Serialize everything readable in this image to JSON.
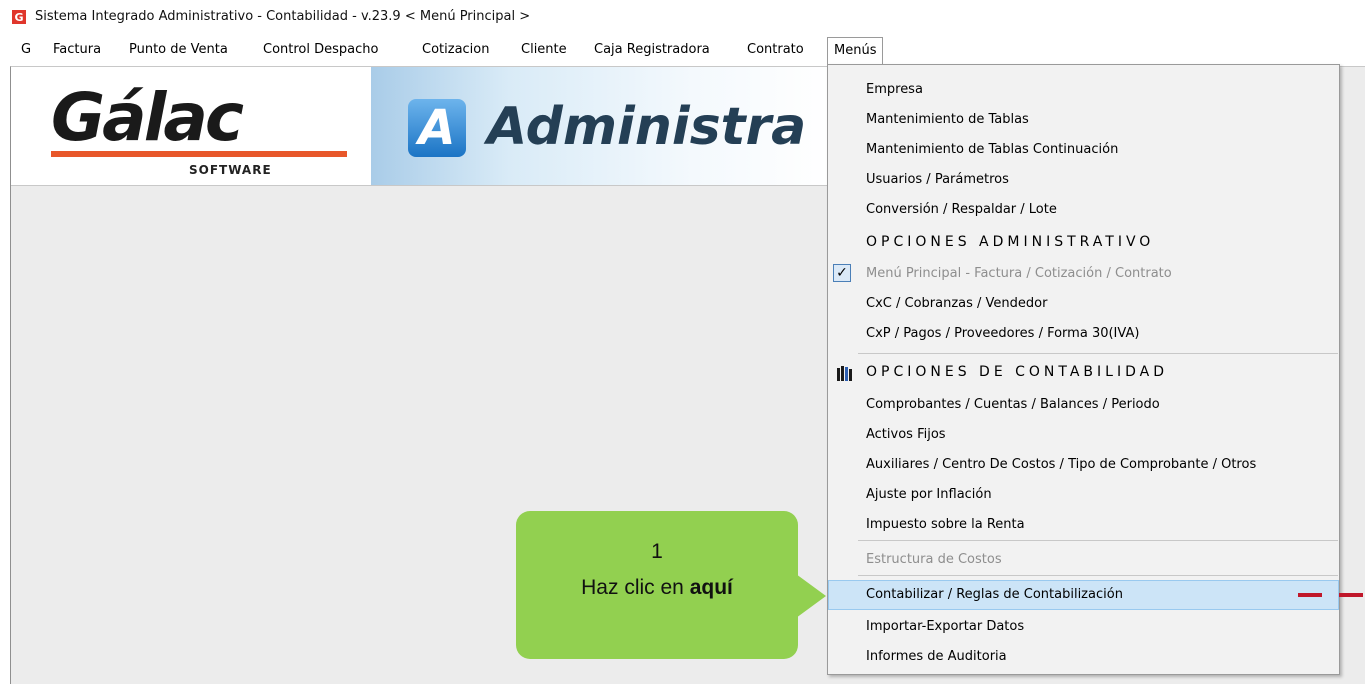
{
  "window": {
    "title": "Sistema Integrado Administrativo - Contabilidad - v.23.9 < Menú Principal >",
    "icon_letter": "G"
  },
  "menubar": {
    "items": [
      "G",
      "Factura",
      "Punto de Venta",
      "Control Despacho",
      "Cotizacion",
      "Cliente",
      "Caja Registradora",
      "Contrato",
      "Menús"
    ],
    "active": "Menús"
  },
  "banner": {
    "logo_text": "Gálac",
    "logo_subtext": "SOFTWARE",
    "badge_letter": "A",
    "product_text": "Administra"
  },
  "dropdown": {
    "items": [
      {
        "label": "Empresa",
        "kind": "item"
      },
      {
        "label": "Mantenimiento de Tablas",
        "kind": "item"
      },
      {
        "label": "Mantenimiento de Tablas Continuación",
        "kind": "item"
      },
      {
        "label": "Usuarios / Parámetros",
        "kind": "item"
      },
      {
        "label": "Conversión / Respaldar / Lote",
        "kind": "item"
      },
      {
        "label": "OPCIONES ADMINISTRATIVO",
        "kind": "section"
      },
      {
        "label": "Menú Principal - Factura / Cotización / Contrato",
        "kind": "item",
        "checked": true,
        "disabled": true
      },
      {
        "label": "CxC / Cobranzas / Vendedor",
        "kind": "item"
      },
      {
        "label": "CxP / Pagos / Proveedores / Forma 30(IVA)",
        "kind": "item"
      },
      {
        "label": "OPCIONES DE CONTABILIDAD",
        "kind": "section",
        "icon": "books-icon"
      },
      {
        "label": "Comprobantes / Cuentas / Balances / Periodo",
        "kind": "item"
      },
      {
        "label": "Activos Fijos",
        "kind": "item"
      },
      {
        "label": "Auxiliares / Centro De Costos / Tipo de Comprobante / Otros",
        "kind": "item"
      },
      {
        "label": "Ajuste por Inflación",
        "kind": "item"
      },
      {
        "label": "Impuesto sobre la Renta",
        "kind": "item"
      },
      {
        "label": "Estructura de Costos",
        "kind": "item",
        "disabled": true
      },
      {
        "label": "Contabilizar / Reglas de Contabilización",
        "kind": "item",
        "highlighted": true
      },
      {
        "label": "Importar-Exportar Datos",
        "kind": "item"
      },
      {
        "label": "Informes de Auditoria",
        "kind": "item"
      }
    ]
  },
  "callout": {
    "number": "1",
    "text_prefix": "Haz clic en ",
    "text_bold": "aquí"
  },
  "colors": {
    "callout": "#92d050",
    "highlight": "#cce4f7",
    "dash": "#c0172a",
    "logo_orange": "#e8572a"
  }
}
